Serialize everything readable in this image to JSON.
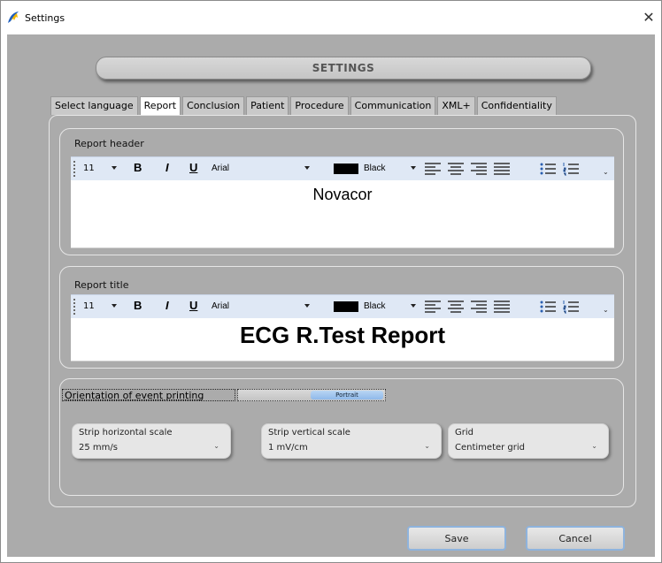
{
  "window": {
    "title": "Settings",
    "app_icon": "lightning-feather-icon",
    "close_icon": "close-icon"
  },
  "header": {
    "title": "SETTINGS"
  },
  "tabs": [
    {
      "label": "Select language",
      "active": false
    },
    {
      "label": "Report",
      "active": true
    },
    {
      "label": "Conclusion",
      "active": false
    },
    {
      "label": "Patient",
      "active": false
    },
    {
      "label": "Procedure",
      "active": false
    },
    {
      "label": "Communication",
      "active": false
    },
    {
      "label": "XML+",
      "active": false
    },
    {
      "label": "Confidentiality",
      "active": false
    }
  ],
  "report_header": {
    "label": "Report header",
    "toolbar": {
      "size": "11",
      "bold": "B",
      "italic": "I",
      "underline": "U",
      "font": "Arial",
      "color_name": "Black",
      "color": "#000000"
    },
    "text": "Novacor"
  },
  "report_title": {
    "label": "Report title",
    "toolbar": {
      "size": "11",
      "bold": "B",
      "italic": "I",
      "underline": "U",
      "font": "Arial",
      "color_name": "Black",
      "color": "#000000"
    },
    "text": "ECG R.Test Report"
  },
  "orientation": {
    "label": "Orientation of event printing",
    "value": "Portrait"
  },
  "strip_horizontal": {
    "label": "Strip horizontal scale",
    "value": "25 mm/s"
  },
  "strip_vertical": {
    "label": "Strip vertical scale",
    "value": "1 mV/cm"
  },
  "grid": {
    "label": "Grid",
    "value": "Centimeter grid"
  },
  "buttons": {
    "save": "Save",
    "cancel": "Cancel"
  },
  "colors": {
    "client_bg": "#ababab",
    "toolbar_bg": "#dfe8f5",
    "button_border": "#8eb3dd",
    "toggle_accent": "#8fb9ea"
  }
}
